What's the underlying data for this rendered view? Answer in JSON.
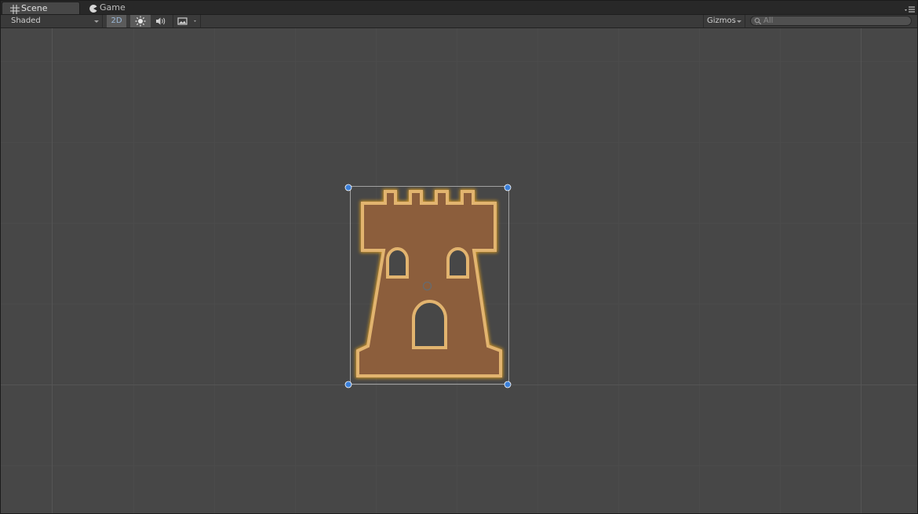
{
  "tabs": [
    {
      "label": "Scene",
      "icon": "grid-hash-icon",
      "active": true
    },
    {
      "label": "Game",
      "icon": "pacman-icon",
      "active": false
    }
  ],
  "toolbar": {
    "shading_mode": "Shaded",
    "mode_2d_label": "2D",
    "lighting_icon": "sun-icon",
    "audio_icon": "speaker-icon",
    "effects_icon": "image-icon",
    "gizmos_label": "Gizmos",
    "search_placeholder": "All"
  },
  "scene": {
    "sprite": "castle-tower-sprite",
    "colors": {
      "background": "#474747",
      "sprite_fill": "#8c5e3c",
      "sprite_outline": "#e2b46f",
      "sprite_glow": "#e0a020",
      "handle": "#3b7fd8"
    }
  }
}
